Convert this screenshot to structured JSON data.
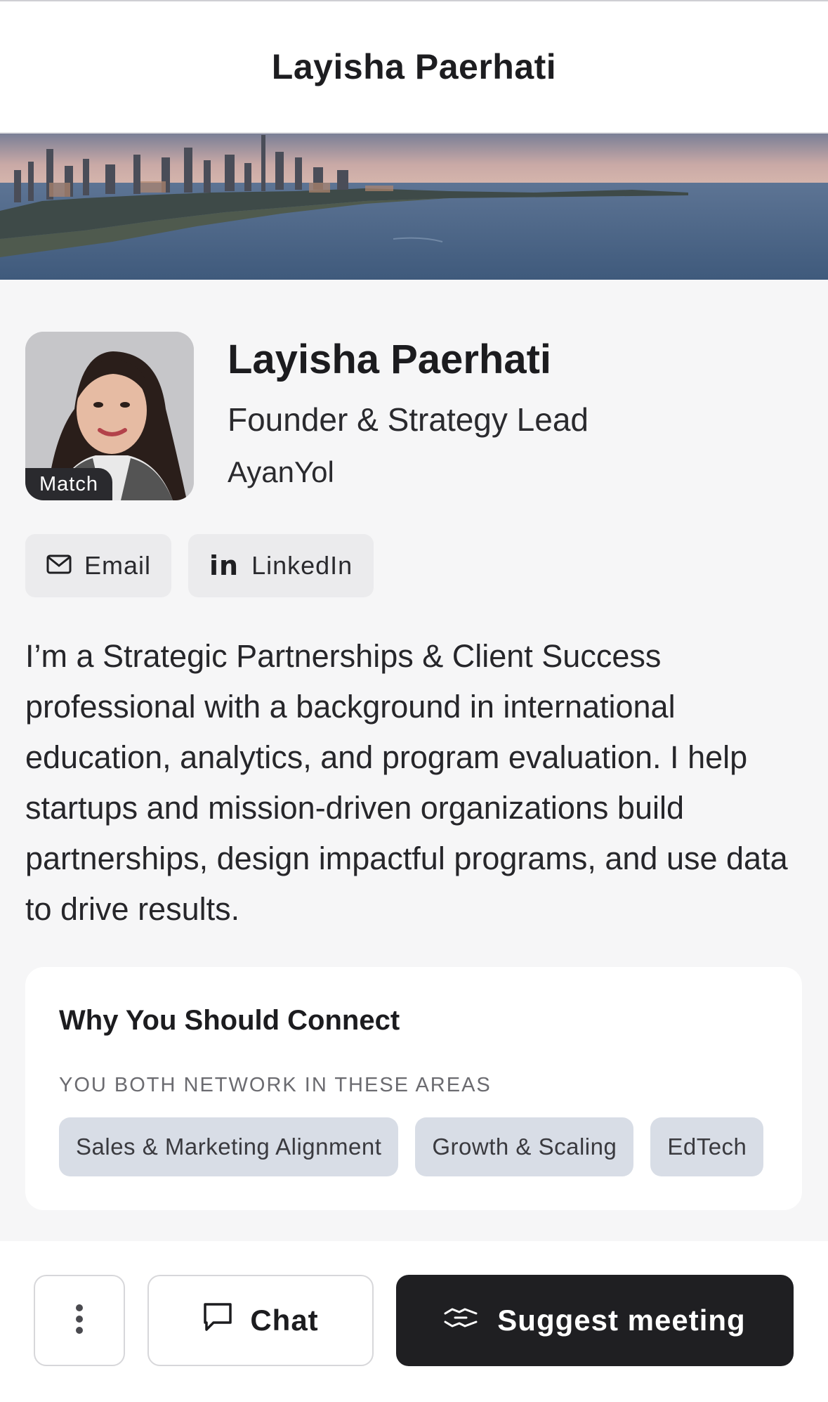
{
  "header": {
    "title": "Layisha Paerhati"
  },
  "profile": {
    "name": "Layisha Paerhati",
    "title": "Founder & Strategy Lead",
    "company": "AyanYol",
    "badge": "Match"
  },
  "contact": {
    "email_label": "Email",
    "linkedin_label": "LinkedIn",
    "linkedin_glyph": "in"
  },
  "bio": "I’m a Strategic Partnerships & Client Success professional with a background in international education, analytics, and program evaluation. I help startups and mission-driven organizations build partnerships, design impactful programs, and use data to drive results.",
  "connect": {
    "title": "Why You Should Connect",
    "subtitle": "YOU BOTH NETWORK IN THESE AREAS",
    "tags": [
      "Sales & Marketing Alignment",
      "Growth & Scaling",
      "EdTech"
    ]
  },
  "actions": {
    "chat_label": "Chat",
    "suggest_label": "Suggest meeting"
  },
  "icons": {
    "email": "envelope-icon",
    "linkedin": "linkedin-icon",
    "more": "vertical-ellipsis-icon",
    "chat": "chat-bubble-icon",
    "suggest": "handshake-icon"
  },
  "colors": {
    "primary_button": "#1f1f22",
    "tag_background": "#d8dde6",
    "page_background": "#f6f6f7"
  }
}
